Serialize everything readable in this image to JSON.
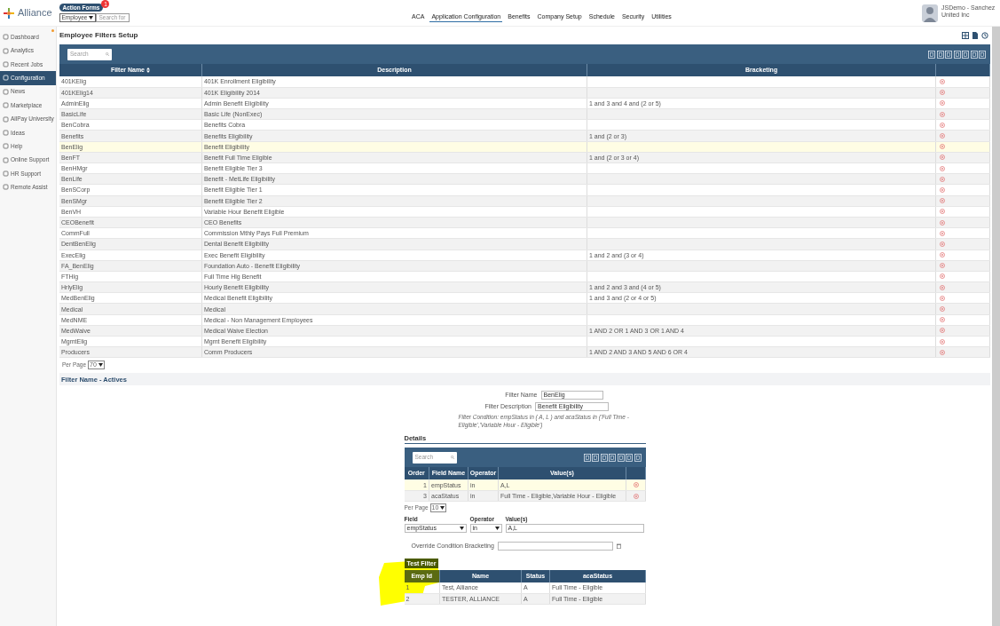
{
  "header": {
    "logo": "Alliance",
    "action_forms": {
      "label": "Action Forms",
      "badge": "1"
    },
    "employee_select": "Employee",
    "search_placeholder": "Search for",
    "nav": [
      {
        "label": "ACA",
        "selected": false
      },
      {
        "label": "Application Configuration",
        "selected": true
      },
      {
        "label": "Benefits",
        "selected": false
      },
      {
        "label": "Company Setup",
        "selected": false
      },
      {
        "label": "Schedule",
        "selected": false
      },
      {
        "label": "Security",
        "selected": false
      },
      {
        "label": "Utilities",
        "selected": false
      }
    ],
    "user": "JSDemo - Sanchez United Inc"
  },
  "sidebar": {
    "items": [
      {
        "label": "Dashboard",
        "selected": false
      },
      {
        "label": "Analytics",
        "selected": false
      },
      {
        "label": "Recent Jobs",
        "selected": false
      },
      {
        "label": "Configuration",
        "selected": true
      },
      {
        "label": "News",
        "selected": false
      },
      {
        "label": "Marketplace",
        "selected": false
      },
      {
        "label": "AllPay University",
        "selected": false
      },
      {
        "label": "Ideas",
        "selected": false
      },
      {
        "label": "Help",
        "selected": false
      },
      {
        "label": "Online Support",
        "selected": false
      },
      {
        "label": "HR Support",
        "selected": false
      },
      {
        "label": "Remote Assist",
        "selected": false
      }
    ]
  },
  "page_title": "Employee Filters Setup",
  "table": {
    "search_placeholder": "Search",
    "columns": [
      {
        "label": "Filter Name",
        "sorted": true
      },
      {
        "label": "Description",
        "sorted": false
      },
      {
        "label": "Bracketing",
        "sorted": false
      }
    ],
    "rows": [
      {
        "name": "401KElig",
        "description": "401K Enrollment Eligibility",
        "bracketing": "",
        "selected": false
      },
      {
        "name": "401KElig14",
        "description": "401K Eligibility 2014",
        "bracketing": "",
        "selected": false
      },
      {
        "name": "AdminElig",
        "description": "Admin Benefit Eligibility",
        "bracketing": "1 and 3 and 4 and (2 or 5)",
        "selected": false
      },
      {
        "name": "BasicLife",
        "description": "Basic Life (NonExec)",
        "bracketing": "",
        "selected": false
      },
      {
        "name": "BenCobra",
        "description": "Benefits Cobra",
        "bracketing": "",
        "selected": false
      },
      {
        "name": "Benefits",
        "description": "Benefits Eligibility",
        "bracketing": "1 and (2 or 3)",
        "selected": false
      },
      {
        "name": "BenElig",
        "description": "Benefit Eligibility",
        "bracketing": "",
        "selected": true
      },
      {
        "name": "BenFT",
        "description": "Benefit Full Time Eligible",
        "bracketing": "1 and (2 or 3 or 4)",
        "selected": false
      },
      {
        "name": "BenHMgr",
        "description": "Benefit Eligible Tier 3",
        "bracketing": "",
        "selected": false
      },
      {
        "name": "BenLife",
        "description": "Benefit - MetLife Eligibility",
        "bracketing": "",
        "selected": false
      },
      {
        "name": "BenSCorp",
        "description": "Benefit Eligible Tier 1",
        "bracketing": "",
        "selected": false
      },
      {
        "name": "BenSMgr",
        "description": "Benefit Eligible Tier 2",
        "bracketing": "",
        "selected": false
      },
      {
        "name": "BenVH",
        "description": "Variable Hour Benefit Eligible",
        "bracketing": "",
        "selected": false
      },
      {
        "name": "CEOBenefit",
        "description": "CEO Benefits",
        "bracketing": "",
        "selected": false
      },
      {
        "name": "CommFull",
        "description": "Commission Mthly Pays Full Premium",
        "bracketing": "",
        "selected": false
      },
      {
        "name": "DentBenElig",
        "description": "Dental Benefit Eligibility",
        "bracketing": "",
        "selected": false
      },
      {
        "name": "ExecElig",
        "description": "Exec Benefit Eligibility",
        "bracketing": "1 and 2 and (3 or 4)",
        "selected": false
      },
      {
        "name": "FA_BenElig",
        "description": "Foundation Auto - Benefit Eligibility",
        "bracketing": "",
        "selected": false
      },
      {
        "name": "FTHlg",
        "description": "Full Time Hlg Benefit",
        "bracketing": "",
        "selected": false
      },
      {
        "name": "HrlyElig",
        "description": "Hourly Benefit Eligibility",
        "bracketing": "1 and 2 and 3 and (4 or 5)",
        "selected": false
      },
      {
        "name": "MedBenElig",
        "description": "Medical Benefit Eligibility",
        "bracketing": "1 and 3 and (2 or 4 or 5)",
        "selected": false
      },
      {
        "name": "Medical",
        "description": "Medical",
        "bracketing": "",
        "selected": false
      },
      {
        "name": "MedNME",
        "description": "Medical - Non Management Employees",
        "bracketing": "",
        "selected": false
      },
      {
        "name": "MedWaive",
        "description": "Medical Waive Election",
        "bracketing": "1 AND 2 OR 1 AND 3 OR 1 AND 4",
        "selected": false
      },
      {
        "name": "MgmtElig",
        "description": "Mgmt Benefit Eligibility",
        "bracketing": "",
        "selected": false
      },
      {
        "name": "Producers",
        "description": "Comm Producers",
        "bracketing": "1 AND 2 AND 3 AND 5 AND 6 OR 4",
        "selected": false
      }
    ],
    "per_page": {
      "label": "Per Page",
      "value": "70"
    }
  },
  "section_title": "Filter Name - Actives",
  "form": {
    "filter_name": {
      "label": "Filter Name",
      "value": "BenElig"
    },
    "filter_description": {
      "label": "Filter Description",
      "value": "Benefit Eligibility"
    },
    "condition": "Filter Condition: empStatus in ( A, L ) and acaStatus in ('Full Time - Eligible','Variable Hour - Eligible')"
  },
  "details": {
    "title": "Details",
    "search_placeholder": "Search",
    "columns": [
      "Order",
      "Field Name",
      "Operator",
      "Value(s)"
    ],
    "rows": [
      {
        "order": "1",
        "field": "empStatus",
        "operator": "in",
        "values": "A,L",
        "selected": true
      },
      {
        "order": "3",
        "field": "acaStatus",
        "operator": "in",
        "values": "Full Time - Eligible,Variable Hour - Eligible",
        "selected": false
      }
    ],
    "per_page": {
      "label": "Per Page",
      "value": "10"
    }
  },
  "editor": {
    "field": {
      "label": "Field",
      "value": "empStatus"
    },
    "operator": {
      "label": "Operator",
      "value": "in"
    },
    "values": {
      "label": "Value(s)",
      "value": "A,L"
    },
    "override": {
      "label": "Override Condition Bracketing"
    },
    "test_button": "Test Filter"
  },
  "results": {
    "columns": [
      "Emp Id",
      "Name",
      "Status",
      "acaStatus"
    ],
    "rows": [
      [
        "1",
        "Test, Alliance",
        "A",
        "Full Time - Eligible"
      ],
      [
        "2",
        "TESTER, ALLIANCE",
        "A",
        "Full Time - Eligible"
      ]
    ]
  }
}
